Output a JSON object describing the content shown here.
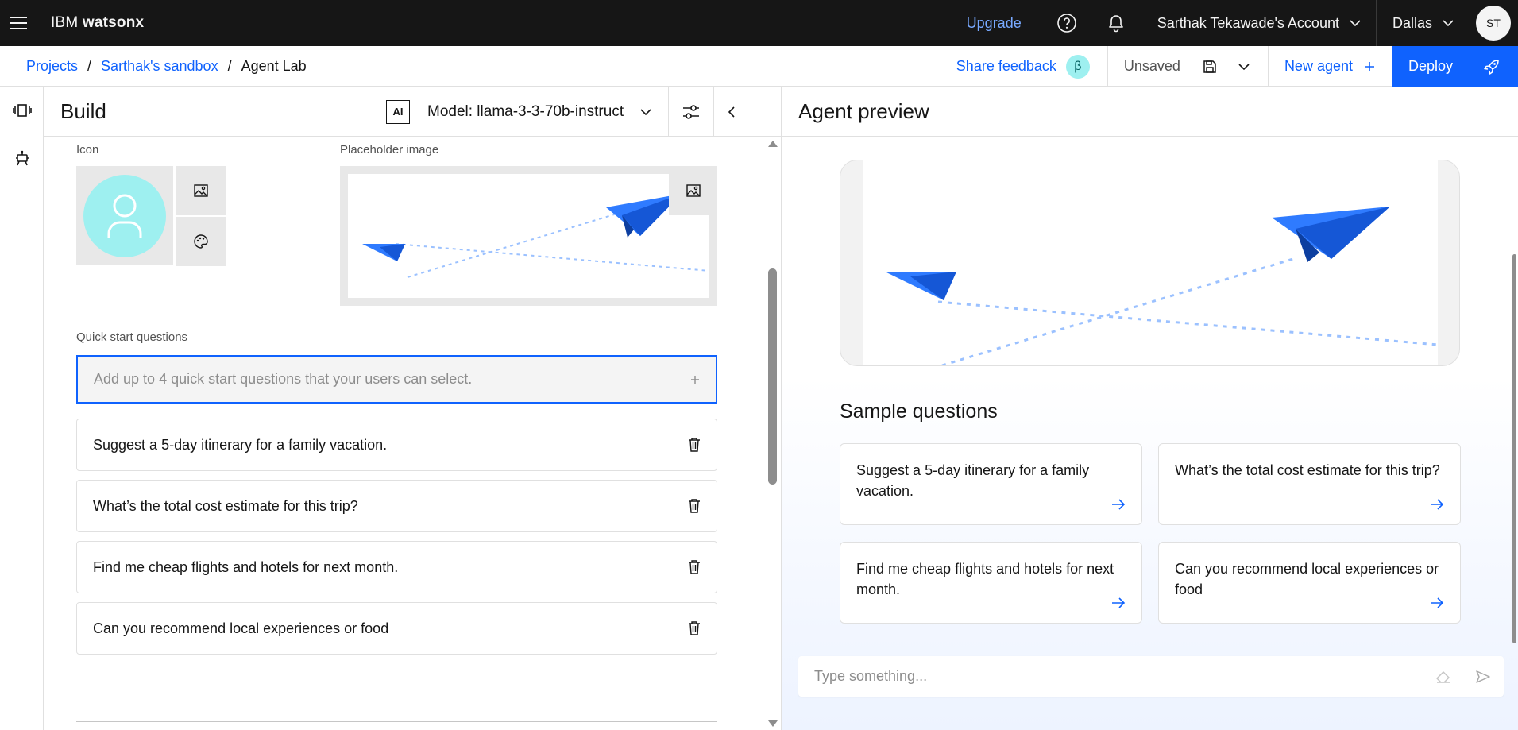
{
  "header": {
    "brand_prefix": "IBM",
    "brand_name": "watsonx",
    "upgrade_label": "Upgrade",
    "account_label": "Sarthak Tekawade's Account",
    "region_label": "Dallas",
    "avatar_initials": "ST"
  },
  "breadcrumb": {
    "items": [
      "Projects",
      "Sarthak's sandbox",
      "Agent Lab"
    ],
    "separator": "/"
  },
  "actions": {
    "share_feedback": "Share feedback",
    "beta_symbol": "β",
    "unsaved": "Unsaved",
    "new_agent": "New agent",
    "deploy": "Deploy"
  },
  "build": {
    "title": "Build",
    "ai_badge": "AI",
    "model_label": "Model: llama-3-3-70b-instruct",
    "icon_label": "Icon",
    "placeholder_label": "Placeholder image",
    "quick_start_label": "Quick start questions",
    "quick_start_placeholder": "Add up to 4 quick start questions that your users can select.",
    "questions": [
      "Suggest a 5-day itinerary for a family vacation.",
      "What’s the total cost estimate for this trip?",
      "Find me cheap flights and hotels for next month.",
      "Can you recommend local experiences or food"
    ]
  },
  "preview": {
    "title": "Agent preview",
    "sample_title": "Sample questions",
    "sample_questions": [
      "Suggest a 5-day itinerary for a family vacation.",
      "What’s the total cost estimate for this trip?",
      "Find me cheap flights and hotels for next month.",
      "Can you recommend local experiences or food"
    ],
    "chat_placeholder": "Type something..."
  },
  "colors": {
    "accent": "#0f62fe",
    "header_bg": "#161616",
    "icon_avatar_bg": "#9ef0f0",
    "plane": "#2f7bff"
  }
}
